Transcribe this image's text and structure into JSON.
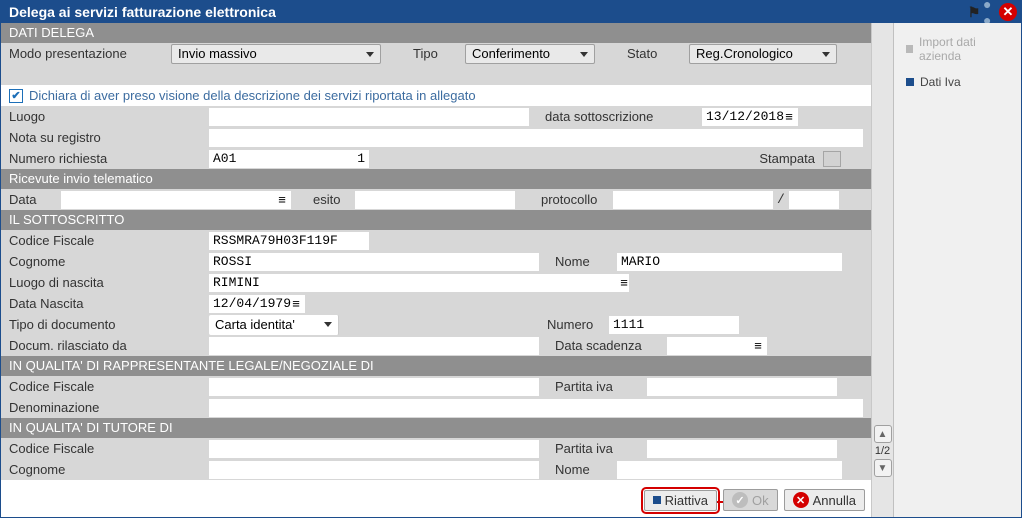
{
  "title": "Delega ai servizi fatturazione elettronica",
  "sidebar": {
    "import": "Import dati azienda",
    "dati_iva": "Dati Iva"
  },
  "sections": {
    "delega": "DATI DELEGA",
    "ricevute": "Ricevute invio telematico",
    "sottoscritto": "IL SOTTOSCRITTO",
    "rappresentante": "IN QUALITA' DI RAPPRESENTANTE LEGALE/NEGOZIALE  DI",
    "tutore": "IN QUALITA' DI TUTORE DI"
  },
  "delega": {
    "modo_label": "Modo presentazione",
    "modo_value": "Invio massivo",
    "tipo_label": "Tipo",
    "tipo_value": "Conferimento",
    "stato_label": "Stato",
    "stato_value": "Reg.Cronologico",
    "dichiara": "Dichiara di aver preso visione della descrizione dei servizi riportata in allegato",
    "luogo_label": "Luogo",
    "luogo_value": "",
    "data_sotto_label": "data sottoscrizione",
    "data_sotto_value": "13/12/2018",
    "nota_label": "Nota su registro",
    "nota_value": "",
    "num_rich_label": "Numero richiesta",
    "num_rich_value": "A01",
    "num_rich_seq": "1",
    "stampata_label": "Stampata"
  },
  "ricevute": {
    "data_label": "Data",
    "data_value": "",
    "esito_label": "esito",
    "esito_value": "",
    "protocollo_label": "protocollo",
    "protocollo_value": "",
    "sep": "/"
  },
  "sotto": {
    "cf_label": "Codice Fiscale",
    "cf_value": "RSSMRA79H03F119F",
    "cognome_label": "Cognome",
    "cognome_value": "ROSSI",
    "nome_label": "Nome",
    "nome_value": "MARIO",
    "luogo_nascita_label": "Luogo di nascita",
    "luogo_nascita_value": "RIMINI",
    "data_nascita_label": "Data Nascita",
    "data_nascita_value": "12/04/1979",
    "tipo_doc_label": "Tipo di documento",
    "tipo_doc_value": "Carta identita'",
    "numero_label": "Numero",
    "numero_value": "1111",
    "rilasciato_label": "Docum. rilasciato da",
    "rilasciato_value": "",
    "scadenza_label": "Data scadenza",
    "scadenza_value": ""
  },
  "rappr": {
    "cf_label": "Codice Fiscale",
    "cf_value": "",
    "piva_label": "Partita iva",
    "piva_value": "",
    "denom_label": "Denominazione",
    "denom_value": ""
  },
  "tut": {
    "cf_label": "Codice Fiscale",
    "cf_value": "",
    "piva_label": "Partita iva",
    "piva_value": "",
    "cognome_label": "Cognome",
    "cognome_value": "",
    "nome_label": "Nome",
    "nome_value": ""
  },
  "pager": "1/2",
  "buttons": {
    "riattiva": "Riattiva",
    "ok": "Ok",
    "annulla": "Annulla"
  }
}
